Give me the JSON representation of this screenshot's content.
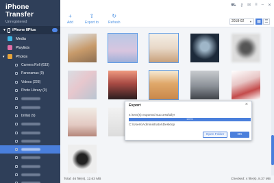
{
  "app": {
    "title": "iPhone Transfer",
    "subtitle": "Unregistered"
  },
  "device": {
    "name": "iPhone 8Plus"
  },
  "sidebar": {
    "items": [
      {
        "label": "Media",
        "icon": "media-icon",
        "color": "#3db6e6"
      },
      {
        "label": "Playlists",
        "icon": "playlist-icon",
        "color": "#e36fa7"
      },
      {
        "label": "Photos",
        "icon": "photos-icon",
        "color": "#e8a43a"
      }
    ],
    "photo_albums": [
      {
        "label": "Camera Roll (633)"
      },
      {
        "label": "Panoramas (9)"
      },
      {
        "label": "Videos (228)"
      },
      {
        "label": "Photo Library (0)"
      },
      {
        "label": ""
      },
      {
        "label": ""
      },
      {
        "label": "brilliat (9)"
      },
      {
        "label": ""
      },
      {
        "label": ""
      },
      {
        "label": ""
      },
      {
        "label": "",
        "active": true
      },
      {
        "label": ""
      },
      {
        "label": ""
      },
      {
        "label": ""
      },
      {
        "label": ""
      }
    ]
  },
  "toolbar": {
    "add_label": "Add",
    "export_label": "Export to",
    "refresh_label": "Refresh",
    "date_value": "2018-02",
    "window_controls": [
      "cart-icon",
      "key-icon",
      "chat-icon",
      "menu-icon",
      "minimize-icon",
      "close-icon"
    ]
  },
  "status": {
    "total": "Total: 46 file(s), 12.63 MB",
    "checked": "Checked: 4 file(s), 8.37 MB"
  },
  "dialog": {
    "title": "Export",
    "message": "4 item(s) exported successfully!",
    "progress_text": "100%",
    "progress": 1.0,
    "path": "C:\\Users\\Administrator\\Desktop",
    "open_folder_label": "Open Folder",
    "ok_label": "OK"
  },
  "colors": {
    "accent": "#4a7fdc",
    "sidebar": "#2f3f59"
  }
}
